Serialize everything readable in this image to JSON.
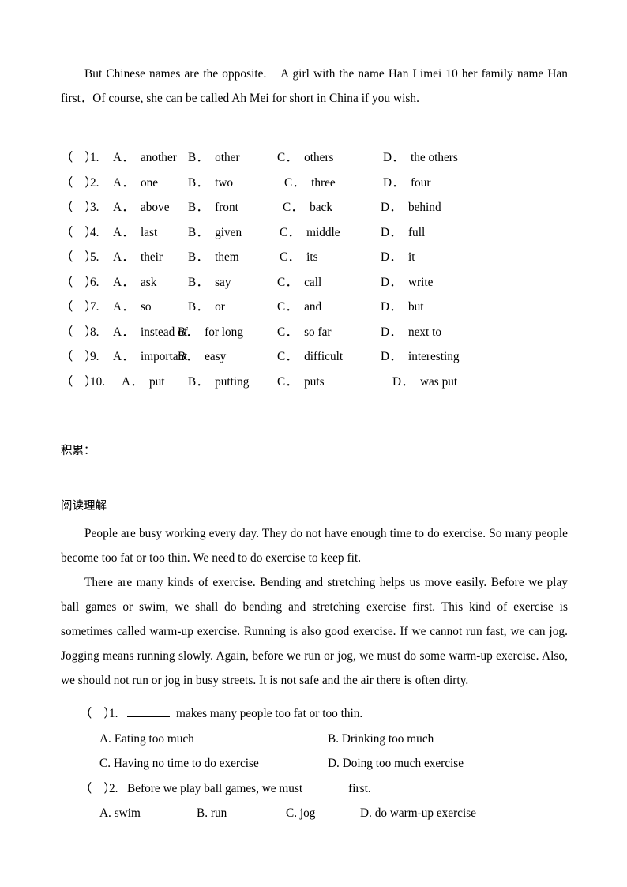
{
  "document": {
    "intro_paragraphs": [
      "But Chinese names are the opposite.　A girl with the name Han Limei 10 her family name Han first．Of course, she can be called Ah Mei for short in China if you wish."
    ],
    "cloze": {
      "rows": [
        {
          "paren": "（",
          "close": "）",
          "number": "1.",
          "a_label": "A．",
          "a_text": "another",
          "b_label": "B．",
          "b_text": "other",
          "c_label": "C．",
          "c_text": "others",
          "d_label": "D．",
          "d_text": "the others"
        },
        {
          "paren": "（",
          "close": "）",
          "number": "2.",
          "a_label": "A．",
          "a_text": "one",
          "b_label": "B．",
          "b_text": "two",
          "c_label": "C．",
          "c_text": "three",
          "d_label": "D．",
          "d_text": "four"
        },
        {
          "paren": "（",
          "close": "）",
          "number": "3.",
          "a_label": "A．",
          "a_text": "above",
          "b_label": "B．",
          "b_text": "front",
          "c_label": "C．",
          "c_text": "back",
          "d_label": "D．",
          "d_text": "behind"
        },
        {
          "paren": "（",
          "close": "）",
          "number": "4.",
          "a_label": "A．",
          "a_text": "last",
          "b_label": "B．",
          "b_text": "given",
          "c_label": "C．",
          "c_text": "middle",
          "d_label": "D．",
          "d_text": "full"
        },
        {
          "paren": "（",
          "close": "）",
          "number": "5.",
          "a_label": "A．",
          "a_text": "their",
          "b_label": "B．",
          "b_text": "them",
          "c_label": "C．",
          "c_text": "its",
          "d_label": "D．",
          "d_text": "it"
        },
        {
          "paren": "（",
          "close": "）",
          "number": "6.",
          "a_label": "A．",
          "a_text": "ask",
          "b_label": "B．",
          "b_text": "say",
          "c_label": "C．",
          "c_text": "call",
          "d_label": "D．",
          "d_text": "write"
        },
        {
          "paren": "（",
          "close": "）",
          "number": "7.",
          "a_label": "A．",
          "a_text": "so",
          "b_label": "B．",
          "b_text": "or",
          "c_label": "C．",
          "c_text": "and",
          "d_label": "D．",
          "d_text": "but"
        },
        {
          "paren": "（",
          "close": "）",
          "number": "8.",
          "a_label": "A．",
          "a_text": "instead of",
          "b_label": "B．",
          "b_text": "for long",
          "c_label": "C．",
          "c_text": "so far",
          "d_label": "D．",
          "d_text": "next to"
        },
        {
          "paren": "（",
          "close": "）",
          "number": "9.",
          "a_label": "A．",
          "a_text": "important",
          "b_label": "B．",
          "b_text": "easy",
          "c_label": "C．",
          "c_text": "difficult",
          "d_label": "D．",
          "d_text": "interesting"
        },
        {
          "paren": "（",
          "close": "）",
          "number": "10.",
          "a_label": "A．",
          "a_text": "put",
          "b_label": "B．",
          "b_text": "putting",
          "c_label": "C．",
          "c_text": "puts",
          "d_label": "D．",
          "d_text": "was put"
        }
      ]
    },
    "accumulation": {
      "label": "积累："
    },
    "reading": {
      "heading": "阅读理解",
      "paragraphs": [
        "People are busy working every day. They do not have enough time to do exercise. So many people become too fat or too thin. We need to do exercise to keep fit.",
        "There are many kinds of exercise. Bending and stretching helps us move easily. Before we play ball games or swim, we shall do bending and stretching exercise first. This kind of exercise is sometimes called warm-up exercise. Running is also good exercise. If we cannot run fast, we can jog. Jogging means running slowly. Again, before we run or jog, we must do some warm-up exercise. Also, we should not run or jog in busy streets. It is not safe and the air there is often dirty."
      ],
      "questions": [
        {
          "paren": "（",
          "close": "）",
          "number": "1.",
          "stem_after_blank": "makes many people too fat or too thin.",
          "a_text": "A. Eating too much",
          "b_text": "B. Drinking too much",
          "c_text": "C. Having no time to do exercise",
          "d_text": "D. Doing too much exercise"
        },
        {
          "paren": "（",
          "close": "）",
          "number": "2.",
          "stem_before_gap": "Before we play ball games, we must",
          "stem_after_gap": "first.",
          "a_text": "A. swim",
          "b_text": "B. run",
          "c_text": "C. jog",
          "d_text": "D. do warm-up exercise"
        }
      ]
    }
  }
}
